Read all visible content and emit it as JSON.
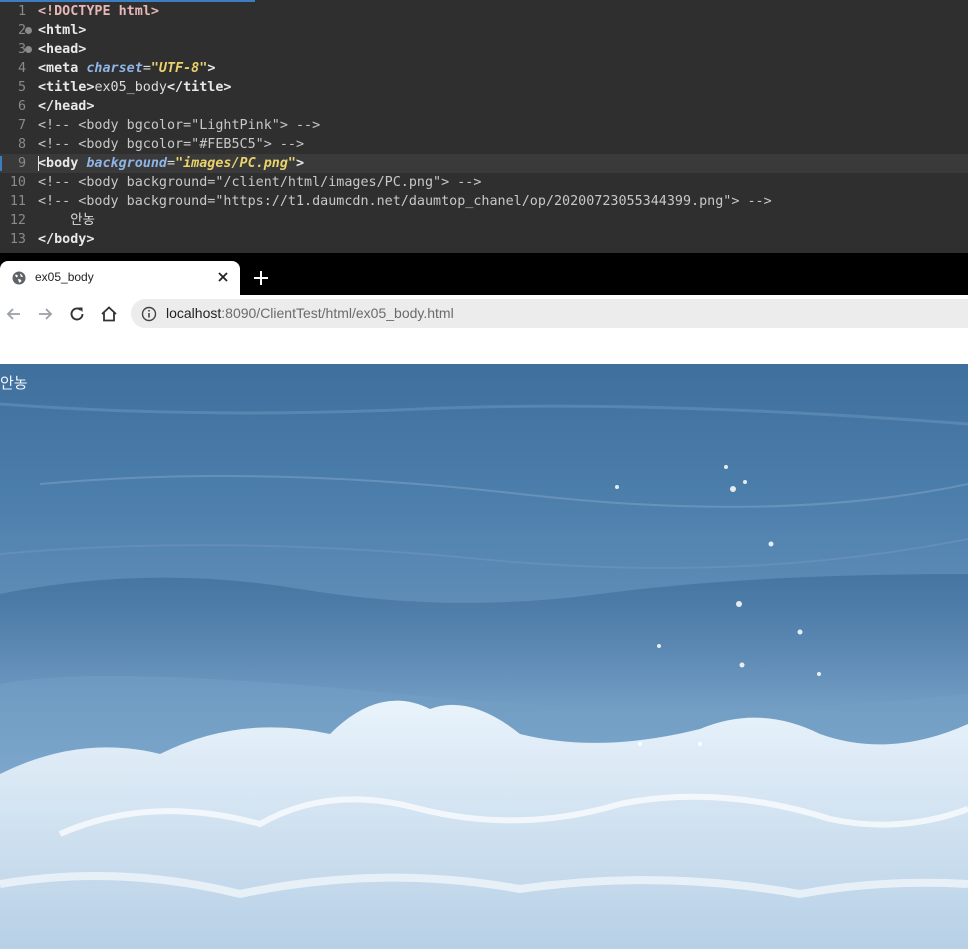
{
  "editor": {
    "lines": [
      {
        "num": "1",
        "segments": [
          {
            "c": "t-doc",
            "t": "<!DOCTYPE "
          },
          {
            "c": "t-doc",
            "t": "html"
          },
          {
            "c": "t-doc",
            "t": ">"
          }
        ]
      },
      {
        "num": "2",
        "segments": [
          {
            "c": "t-tag",
            "t": "<html>"
          }
        ]
      },
      {
        "num": "3",
        "segments": [
          {
            "c": "t-tag",
            "t": "<head>"
          }
        ]
      },
      {
        "num": "4",
        "segments": [
          {
            "c": "t-tag",
            "t": "<meta "
          },
          {
            "c": "t-attr",
            "t": "charset"
          },
          {
            "c": "t-p",
            "t": "="
          },
          {
            "c": "t-val",
            "t": "\"UTF-8\""
          },
          {
            "c": "t-tag",
            "t": ">"
          }
        ]
      },
      {
        "num": "5",
        "segments": [
          {
            "c": "t-tag",
            "t": "<title>"
          },
          {
            "c": "t-txt",
            "t": "ex05_body"
          },
          {
            "c": "t-tag",
            "t": "</title>"
          }
        ]
      },
      {
        "num": "6",
        "segments": [
          {
            "c": "t-tag",
            "t": "</head>"
          }
        ]
      },
      {
        "num": "7",
        "segments": [
          {
            "c": "t-cmt",
            "t": "<!-- <body bgcolor=\"LightPink\"> -->"
          }
        ]
      },
      {
        "num": "8",
        "segments": [
          {
            "c": "t-cmt",
            "t": "<!-- <body bgcolor=\"#FEB5C5\"> -->"
          }
        ]
      },
      {
        "num": "9",
        "segments": [
          {
            "c": "t-tag",
            "t": "<body "
          },
          {
            "c": "t-attr",
            "t": "background"
          },
          {
            "c": "t-p",
            "t": "="
          },
          {
            "c": "t-val",
            "t": "\"images/PC.png\""
          },
          {
            "c": "t-tag",
            "t": ">"
          }
        ]
      },
      {
        "num": "10",
        "segments": [
          {
            "c": "t-cmt",
            "t": "<!-- <body background=\"/client/html/images/PC.png\"> -->"
          }
        ]
      },
      {
        "num": "11",
        "segments": [
          {
            "c": "t-cmt",
            "t": "<!-- <body background=\"https://t1.daumcdn.net/daumtop_chanel/op/20200723055344399.png\"> -->"
          }
        ]
      },
      {
        "num": "12",
        "segments": [
          {
            "c": "t-txt",
            "t": "    안농"
          }
        ]
      },
      {
        "num": "13",
        "segments": [
          {
            "c": "t-tag",
            "t": "</body>"
          }
        ]
      }
    ],
    "fold_lines": [
      "2",
      "3"
    ],
    "current_line": "9"
  },
  "browser": {
    "tab_title": "ex05_body",
    "url_host": "localhost",
    "url_rest": ":8090/ClientTest/html/ex05_body.html"
  },
  "page": {
    "body_text": "안농"
  },
  "colors": {
    "editor_bg": "#2f2f2f",
    "accent": "#3d7dc0",
    "water": "#5e8cb7"
  },
  "icons": [
    "globe-icon",
    "close-icon",
    "plus-icon",
    "back-arrow-icon",
    "forward-arrow-icon",
    "reload-icon",
    "home-icon",
    "info-icon"
  ]
}
